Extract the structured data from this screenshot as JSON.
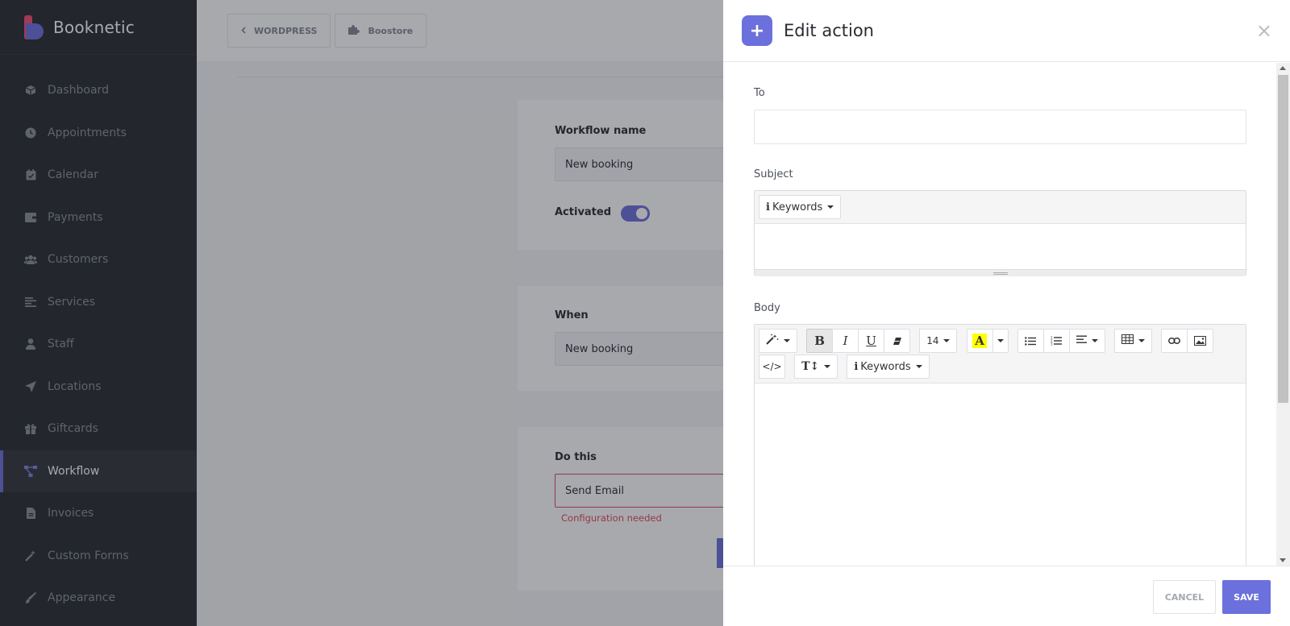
{
  "brand": {
    "name": "Booknetic"
  },
  "sidebar": {
    "items": [
      {
        "label": "Dashboard",
        "icon": "cube-icon"
      },
      {
        "label": "Appointments",
        "icon": "clock-icon"
      },
      {
        "label": "Calendar",
        "icon": "calendar-check-icon"
      },
      {
        "label": "Payments",
        "icon": "wallet-icon"
      },
      {
        "label": "Customers",
        "icon": "users-icon"
      },
      {
        "label": "Services",
        "icon": "list-icon"
      },
      {
        "label": "Staff",
        "icon": "user-icon"
      },
      {
        "label": "Locations",
        "icon": "location-arrow-icon"
      },
      {
        "label": "Giftcards",
        "icon": "gift-icon"
      },
      {
        "label": "Workflow",
        "icon": "workflow-icon",
        "active": true
      },
      {
        "label": "Invoices",
        "icon": "file-icon"
      },
      {
        "label": "Custom Forms",
        "icon": "magic-wand-icon"
      },
      {
        "label": "Appearance",
        "icon": "brush-icon"
      }
    ]
  },
  "topbar": {
    "wordpress_label": "WORDPRESS",
    "boostore_label": "Boostore"
  },
  "workflow": {
    "name_label": "Workflow name",
    "name_value": "New booking",
    "activated_label": "Activated",
    "when_label": "When",
    "when_value": "New booking",
    "do_label": "Do this",
    "do_value": "Send Email",
    "do_error": "Configuration needed"
  },
  "panel": {
    "title": "Edit action",
    "close_glyph": "×",
    "to_label": "To",
    "to_value": "",
    "subject_label": "Subject",
    "subject_keywords": "Keywords",
    "body_label": "Body",
    "body_font_size": "14",
    "body_keywords": "Keywords",
    "cancel_label": "CANCEL",
    "save_label": "SAVE"
  },
  "colors": {
    "accent": "#6c70dc",
    "sidebar_bg": "#292d32",
    "error": "#e04a62"
  }
}
